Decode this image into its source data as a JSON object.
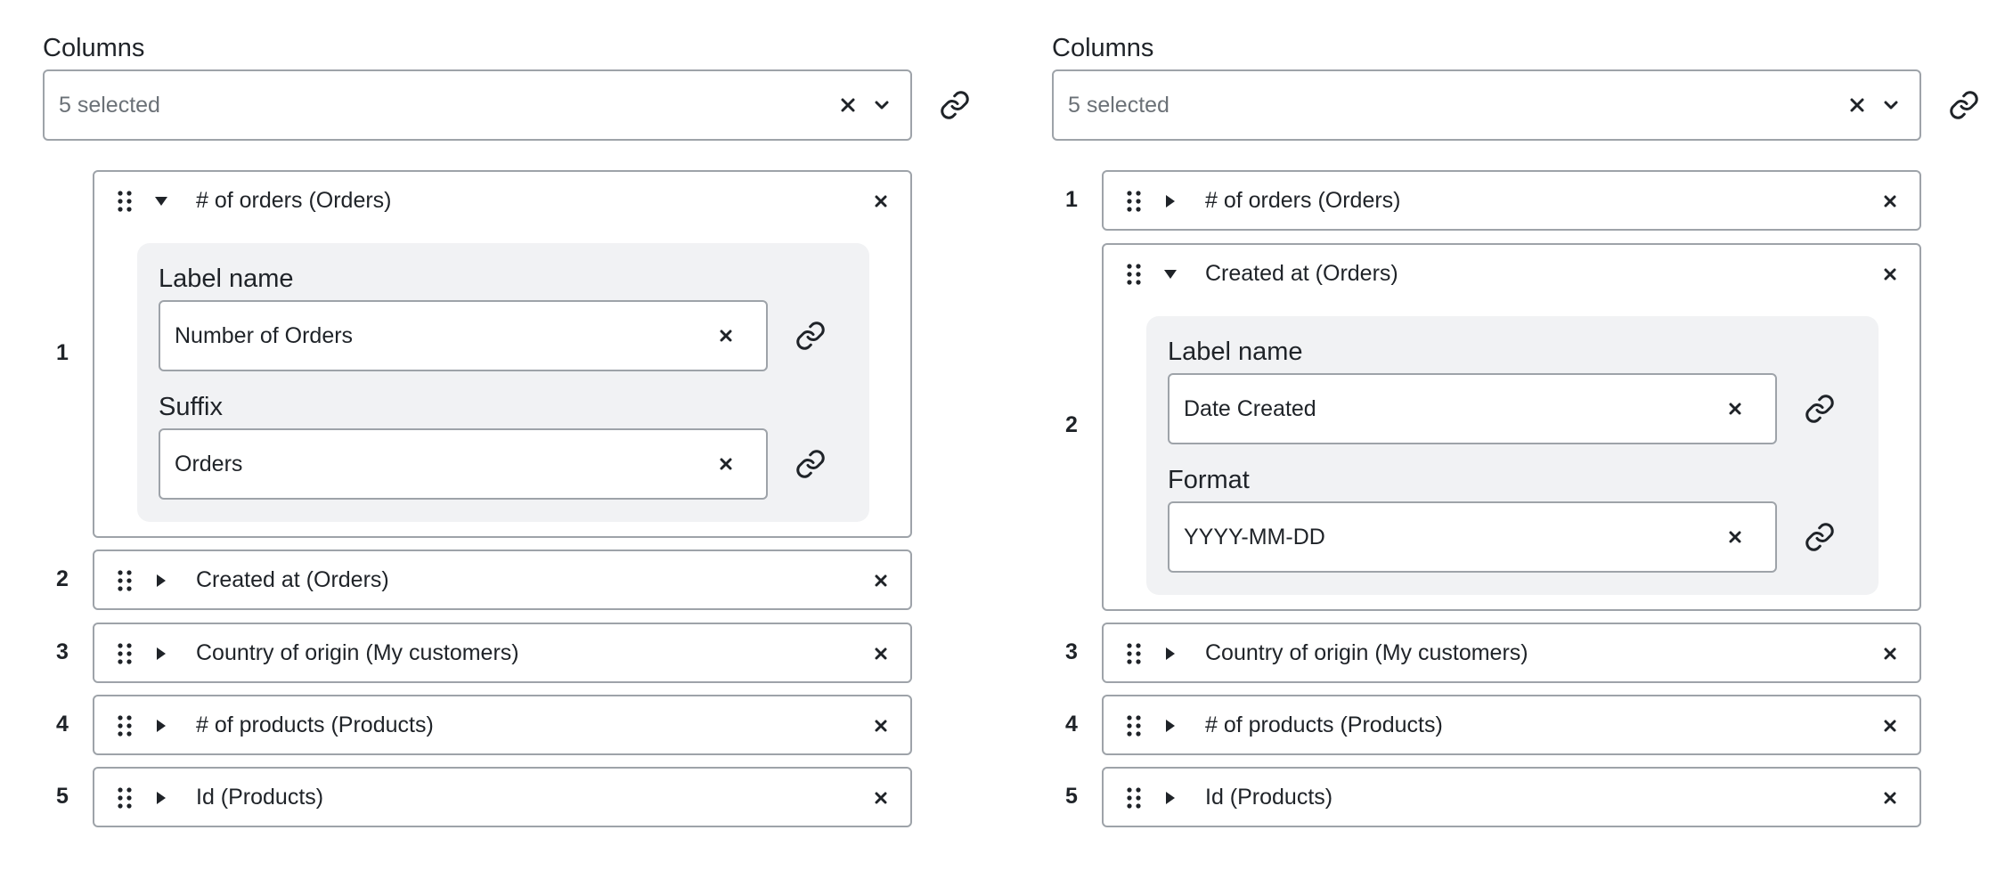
{
  "left": {
    "columns_label": "Columns",
    "select": {
      "value": "5 selected"
    },
    "rows": [
      {
        "num": "1",
        "label": "# of orders (Orders)",
        "expanded": true
      },
      {
        "num": "2",
        "label": "Created at (Orders)",
        "expanded": false
      },
      {
        "num": "3",
        "label": "Country of origin (My customers)",
        "expanded": false
      },
      {
        "num": "4",
        "label": "# of products (Products)",
        "expanded": false
      },
      {
        "num": "5",
        "label": "Id (Products)",
        "expanded": false
      }
    ],
    "settings": {
      "field1_label": "Label name",
      "field1_value": "Number of Orders",
      "field2_label": "Suffix",
      "field2_value": "Orders"
    }
  },
  "right": {
    "columns_label": "Columns",
    "select": {
      "value": "5 selected"
    },
    "rows": [
      {
        "num": "1",
        "label": "# of orders (Orders)",
        "expanded": false
      },
      {
        "num": "2",
        "label": "Created at (Orders)",
        "expanded": true
      },
      {
        "num": "3",
        "label": "Country of origin (My customers)",
        "expanded": false
      },
      {
        "num": "4",
        "label": "# of products (Products)",
        "expanded": false
      },
      {
        "num": "5",
        "label": "Id (Products)",
        "expanded": false
      }
    ],
    "settings": {
      "field1_label": "Label name",
      "field1_value": "Date Created",
      "field2_label": "Format",
      "field2_value": "YYYY-MM-DD"
    }
  },
  "icons": {
    "clear": "close-icon",
    "dropdown": "chevron-down-icon",
    "link": "link-icon",
    "drag": "drag-handle-icon",
    "expand": "triangle-right-icon",
    "collapse": "triangle-down-icon"
  },
  "colors": {
    "border": "#9ea3a9",
    "settings_bg": "#f1f2f4",
    "text": "#1f2328",
    "placeholder": "#6b7177"
  }
}
